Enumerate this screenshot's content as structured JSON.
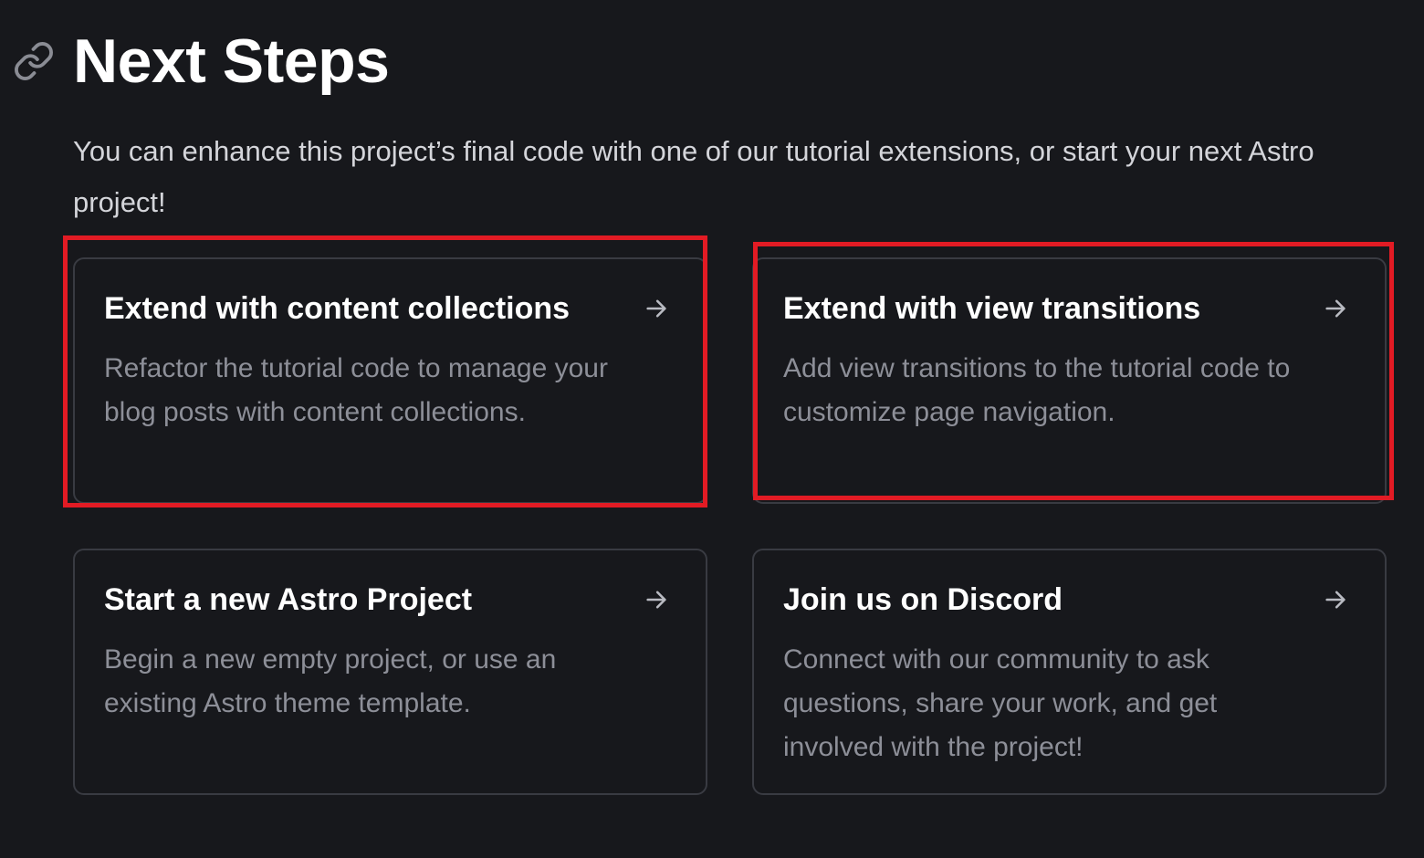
{
  "heading": {
    "title": "Next Steps",
    "anchor_icon": "link-icon"
  },
  "intro": {
    "text": "You can enhance this project’s final code with one of our tutorial extensions, or start your next Astro project!"
  },
  "cards": [
    {
      "title": "Extend with content collections",
      "description": "Refactor the tutorial code to manage your blog posts with content collections.",
      "icon": "arrow-right-icon"
    },
    {
      "title": "Extend with view transitions",
      "description": "Add view transitions to the tutorial code to customize page navigation.",
      "icon": "arrow-right-icon"
    },
    {
      "title": "Start a new Astro Project",
      "description": "Begin a new empty project, or use an existing Astro theme template.",
      "icon": "arrow-right-icon"
    },
    {
      "title": "Join us on Discord",
      "description": "Connect with our community to ask questions, share your work, and get involved with the project!",
      "icon": "arrow-right-icon"
    }
  ],
  "colors": {
    "background": "#17181c",
    "card_border": "#393b42",
    "title_text": "#ffffff",
    "body_text": "#d4d5da",
    "muted_text": "#8d8f98",
    "highlight": "#e21b24"
  }
}
